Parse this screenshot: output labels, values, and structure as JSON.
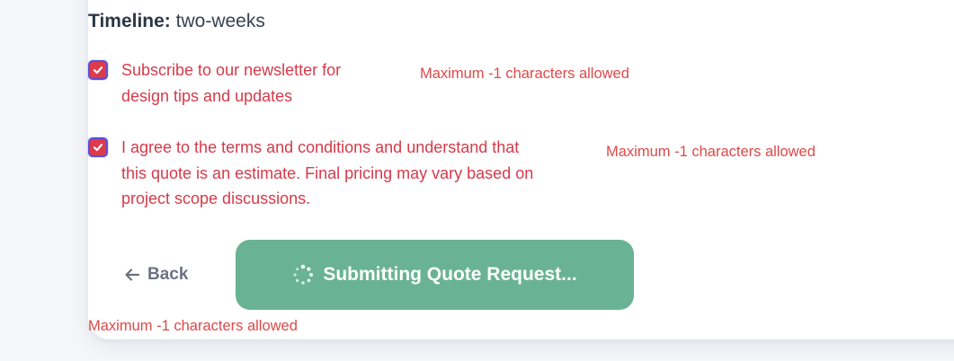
{
  "summary": {
    "timeline_label": "Timeline:",
    "timeline_value": "two-weeks"
  },
  "newsletter": {
    "checked": true,
    "label_line1": "Subscribe to our newsletter for",
    "label_line2": "design tips and updates",
    "error": "Maximum -1 characters allowed"
  },
  "terms": {
    "checked": true,
    "label_line1": "I agree to the terms and conditions and understand that",
    "label_line2": "this quote is an estimate. Final pricing may vary based on",
    "label_line3": "project scope discussions.",
    "error": "Maximum -1 characters allowed"
  },
  "actions": {
    "back_icon": "arrow-left-icon",
    "back_label": "Back",
    "submit_icon": "spinner-icon",
    "submit_label": "Submitting Quote Request...",
    "error": "Maximum -1 characters allowed"
  },
  "colors": {
    "submit_bg": "#69b394",
    "error_text": "#e04848",
    "checkbox_fill": "#dc3b4c",
    "checkbox_border": "#5b4fd8"
  }
}
